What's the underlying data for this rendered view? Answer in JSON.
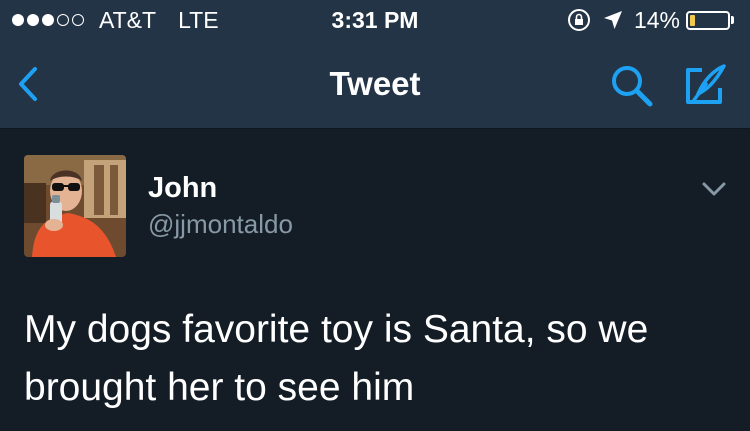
{
  "status_bar": {
    "carrier": "AT&T",
    "network": "LTE",
    "time": "3:31 PM",
    "battery_percent": "14%",
    "battery_level": 0.14,
    "signal_bars_filled": 3,
    "signal_bars_total": 5
  },
  "nav": {
    "title": "Tweet",
    "accent_color": "#1da1f2"
  },
  "tweet": {
    "author_name": "John",
    "author_handle": "@jjmontaldo",
    "text": "My dogs favorite toy is Santa, so we brought her to see him"
  },
  "icons": [
    "back-chevron-icon",
    "search-icon",
    "compose-icon",
    "chevron-down-icon",
    "lock-rotation-icon",
    "location-arrow-icon",
    "battery-icon"
  ],
  "colors": {
    "background": "#141d26",
    "header": "#243447",
    "secondary_text": "#8899a6",
    "battery_low": "#f2c94c"
  }
}
